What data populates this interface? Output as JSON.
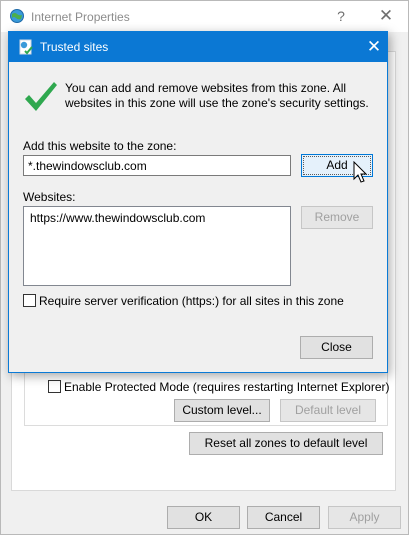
{
  "parent_window": {
    "title": "Internet Properties",
    "help_glyph": "?",
    "close_glyph": "✕",
    "protected_mode": {
      "label": "Enable Protected Mode (requires restarting Internet Explorer)",
      "checked": false
    },
    "custom_level_label": "Custom level...",
    "default_level_label": "Default level",
    "reset_all_label": "Reset all zones to default level",
    "ok_label": "OK",
    "cancel_label": "Cancel",
    "apply_label": "Apply"
  },
  "dialog": {
    "title": "Trusted sites",
    "close_glyph": "✕",
    "info_text": "You can add and remove websites from this zone. All websites in this zone will use the zone's security settings.",
    "add_label": "Add this website to the zone:",
    "site_input_value": "*.thewindowsclub.com",
    "add_button_label": "Add",
    "websites_label": "Websites:",
    "websites": [
      "https://www.thewindowsclub.com"
    ],
    "remove_button_label": "Remove",
    "require_verification": {
      "label": "Require server verification (https:) for all sites in this zone",
      "checked": false
    },
    "close_button_label": "Close"
  },
  "icons": {
    "parent_title_icon": "internet-globe-icon",
    "dialog_title_icon": "trusted-sites-icon",
    "check_mark": "green-check-icon",
    "cursor": "mouse-pointer-icon"
  },
  "colors": {
    "dialog_titlebar": "#0b78d4",
    "check_green": "#2fa84f",
    "focus_border": "#0078d7"
  }
}
